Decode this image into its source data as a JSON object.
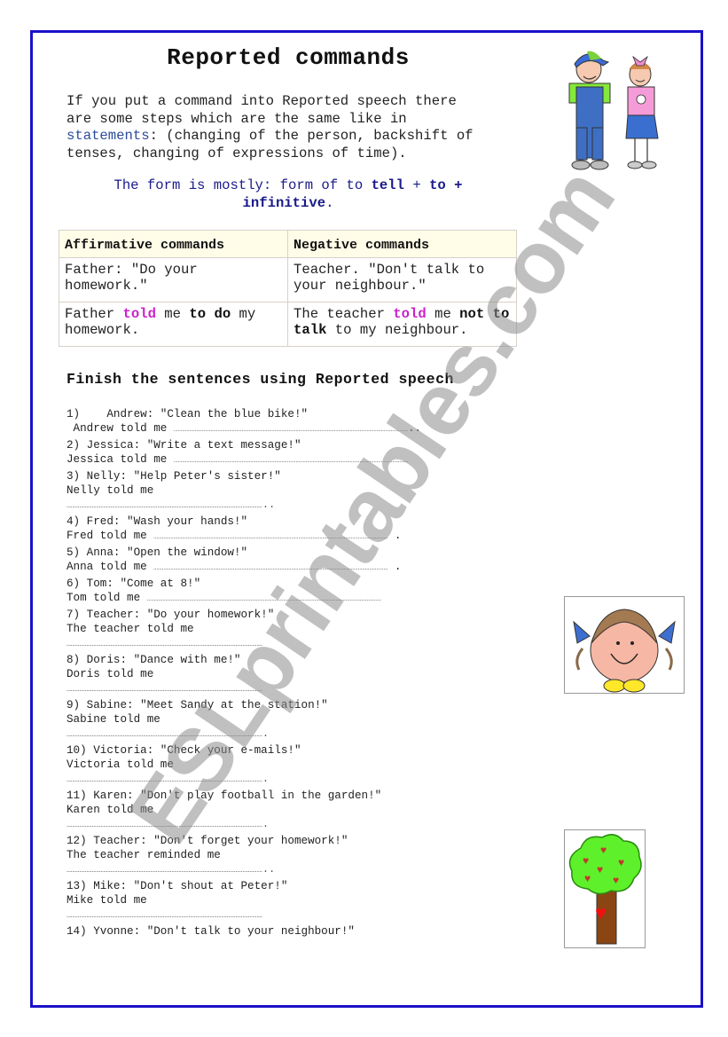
{
  "title": "Reported commands",
  "intro": {
    "line1": "If you put a command into Reported speech there",
    "line2": "are some steps which are the same like in",
    "link": "statements",
    "line3_rest": ": (changing of the person, backshift of",
    "line4": "tenses, changing of expressions of time)."
  },
  "form": {
    "prefix": "The form is mostly: form of to ",
    "tell": "tell",
    "plus1": " + ",
    "to": "to +",
    "infinitive": "infinitive",
    "end": "."
  },
  "table": {
    "headers": [
      "Affirmative commands",
      "Negative commands"
    ],
    "row1": [
      "Father: \"Do your homework.\"",
      "Teacher. \"Don't talk to your neighbour.\""
    ],
    "row2": {
      "left": {
        "a": "Father ",
        "told": "told",
        "b": " me ",
        "bold": "to do",
        "c": " my homework."
      },
      "right": {
        "a": "The teacher ",
        "told": "told",
        "b": " me ",
        "bold": "not to talk",
        "c": " to my neighbour."
      }
    },
    "colors": {
      "highlight": "#cc22cc",
      "header_bg": "#fffce8"
    }
  },
  "section_title": "Finish the sentences using Reported speech",
  "exercises": [
    {
      "q": "1)    Andrew: \"Clean the blue bike!\"",
      "a": " Andrew told me ",
      "dots_inline": true,
      "end": ".."
    },
    {
      "q": "2) Jessica: \"Write a text message!\"",
      "a": "Jessica told me ",
      "dots_inline": true,
      "end": ""
    },
    {
      "q": "3) Nelly: \"Help Peter's sister!\"",
      "a": "Nelly told me",
      "dots_inline": false,
      "end": ".."
    },
    {
      "q": "4) Fred: \"Wash your hands!\"",
      "a": "Fred told me ",
      "dots_inline": true,
      "end": " ."
    },
    {
      "q": "5) Anna: \"Open the window!\"",
      "a": "Anna told me ",
      "dots_inline": true,
      "end": " ."
    },
    {
      "q": "6) Tom: \"Come at 8!\"",
      "a": "Tom told me ",
      "dots_inline": true,
      "end": ""
    },
    {
      "q": "7) Teacher: \"Do your homework!\"",
      "a": "The teacher told me",
      "dots_inline": false,
      "end": ""
    },
    {
      "q": "8) Doris: \"Dance with me!\"",
      "a": "Doris told me",
      "dots_inline": false,
      "end": ""
    },
    {
      "q": "9) Sabine: \"Meet Sandy at the station!\"",
      "a": "Sabine told me",
      "dots_inline": false,
      "end": "."
    },
    {
      "q": "10) Victoria: \"Check your e-mails!\"",
      "a": "Victoria told me",
      "dots_inline": false,
      "end": "."
    },
    {
      "q": "11) Karen: \"Don't play football in the garden!\"",
      "a": "Karen told me",
      "dots_inline": false,
      "end": "."
    },
    {
      "q": "12) Teacher: \"Don't forget your homework!\"",
      "a": "The teacher reminded me",
      "dots_inline": false,
      "end": ".."
    },
    {
      "q": "13) Mike: \"Don't shout at Peter!\"",
      "a": "Mike told me",
      "dots_inline": false,
      "end": ""
    },
    {
      "q": "14) Yvonne: \"Don't talk to your neighbour!\"",
      "a": "",
      "dots_inline": false,
      "end": ""
    }
  ],
  "images": {
    "kids": "kids-clipart",
    "girl": "girl-face-clipart",
    "tree": "heart-tree-clipart"
  },
  "watermark": "ESLprintables.com",
  "colors": {
    "border": "#1a10c8",
    "form_text": "#1a1a8a",
    "link": "#2a4a9a"
  }
}
